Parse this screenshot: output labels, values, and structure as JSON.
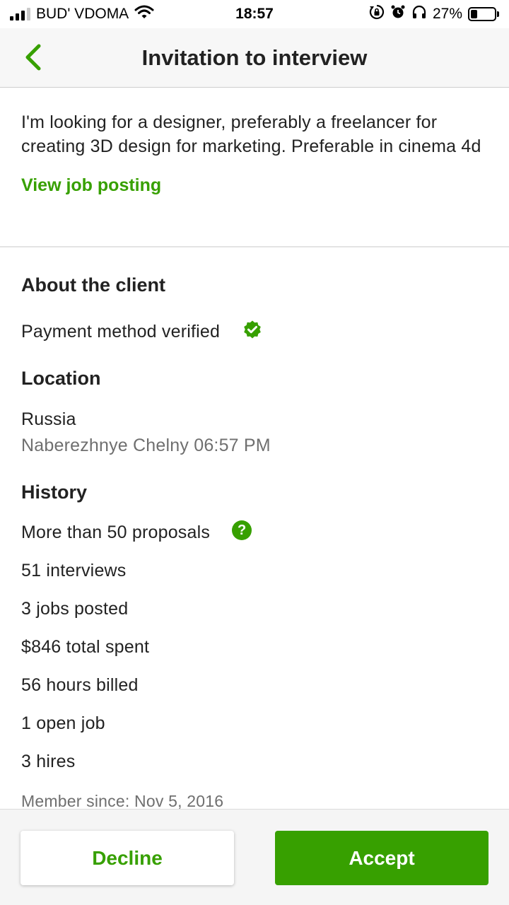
{
  "status_bar": {
    "carrier": "BUD' VDOMA",
    "time": "18:57",
    "battery_percent": "27%",
    "battery_level": 0.27,
    "icons": [
      "signal-icon",
      "wifi-icon",
      "orientation-lock-icon",
      "alarm-icon",
      "headphones-icon",
      "battery-icon"
    ]
  },
  "header": {
    "title": "Invitation to interview",
    "back_icon": "chevron-left-icon"
  },
  "job": {
    "description": "I'm looking for a designer, preferably a freelancer for creating 3D design for marketing. Preferable in cinema 4d",
    "view_link": "View job posting"
  },
  "client": {
    "heading": "About the client",
    "payment": "Payment method verified",
    "payment_icon": "verified-check-icon",
    "location_heading": "Location",
    "country": "Russia",
    "city_time": "Naberezhnye Chelny 06:57 PM",
    "history_heading": "History",
    "history": {
      "proposals": "More than 50 proposals",
      "proposals_icon": "help-question-icon",
      "interviews": "51 interviews",
      "jobs_posted": "3 jobs posted",
      "total_spent": "$846 total spent",
      "hours_billed": "56 hours billed",
      "open_jobs": "1 open job",
      "hires": "3 hires"
    },
    "member_since": "Member since: Nov 5, 2016"
  },
  "actions": {
    "decline": "Decline",
    "accept": "Accept"
  },
  "colors": {
    "accent": "#37a000",
    "text": "#222222",
    "muted": "#6f6f6f"
  }
}
